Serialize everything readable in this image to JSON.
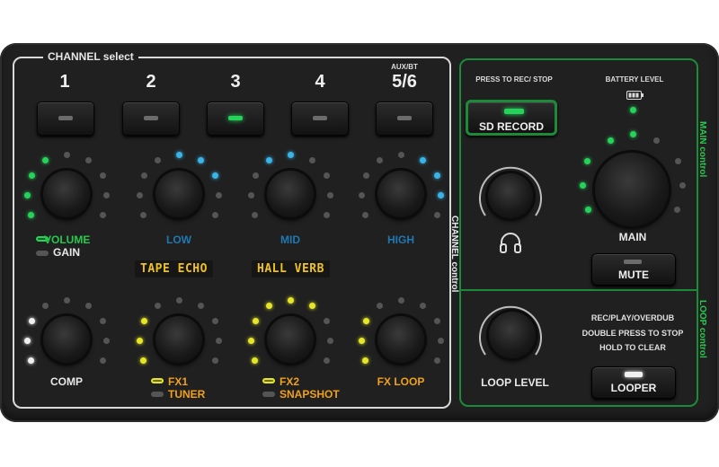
{
  "channel_select": {
    "title": "CHANNEL select",
    "channels": [
      {
        "number": "1",
        "led_on": false
      },
      {
        "number": "2",
        "led_on": false
      },
      {
        "number": "3",
        "led_on": true
      },
      {
        "number": "4",
        "led_on": false
      },
      {
        "number": "5/6",
        "led_on": false,
        "sublabel": "AUX/BT"
      }
    ]
  },
  "channel_control": {
    "side_label": "CHANNEL control",
    "row1_knobs": [
      {
        "label": "VOLUME",
        "sublabel": "GAIN",
        "color": "#28c84e"
      },
      {
        "label": "LOW",
        "color": "#1f78b4"
      },
      {
        "label": "MID",
        "color": "#1f78b4"
      },
      {
        "label": "HIGH",
        "color": "#1f78b4"
      }
    ],
    "displays": [
      "TAPE ECHO",
      "HALL VERB"
    ],
    "row2_knobs": [
      {
        "label": "COMP",
        "color": "#e8e8e8"
      },
      {
        "label": "FX1",
        "sublabel": "TUNER",
        "color": "#f0a01e"
      },
      {
        "label": "FX2",
        "sublabel": "SNAPSHOT",
        "color": "#f0a01e"
      },
      {
        "label": "FX LOOP",
        "color": "#f0a01e"
      }
    ]
  },
  "main_control": {
    "side_label": "MAIN control",
    "press_to_rec": "PRESS TO REC/ STOP",
    "sd_record_label": "SD RECORD",
    "battery_label": "BATTERY LEVEL",
    "headphone_icon": "headphones-icon",
    "main_label": "MAIN",
    "mute_label": "MUTE"
  },
  "loop_control": {
    "side_label": "LOOP control",
    "loop_level_label": "LOOP LEVEL",
    "instructions": [
      "REC/PLAY/OVERDUB",
      "DOUBLE PRESS TO STOP",
      "HOLD TO CLEAR"
    ],
    "looper_label": "LOOPER"
  },
  "colors": {
    "green": "#25d35a",
    "blue": "#3ab4e6",
    "yellow": "#e6e628",
    "orange": "#f0a01e",
    "white": "#f0f0f0",
    "led_off": "#555555"
  }
}
